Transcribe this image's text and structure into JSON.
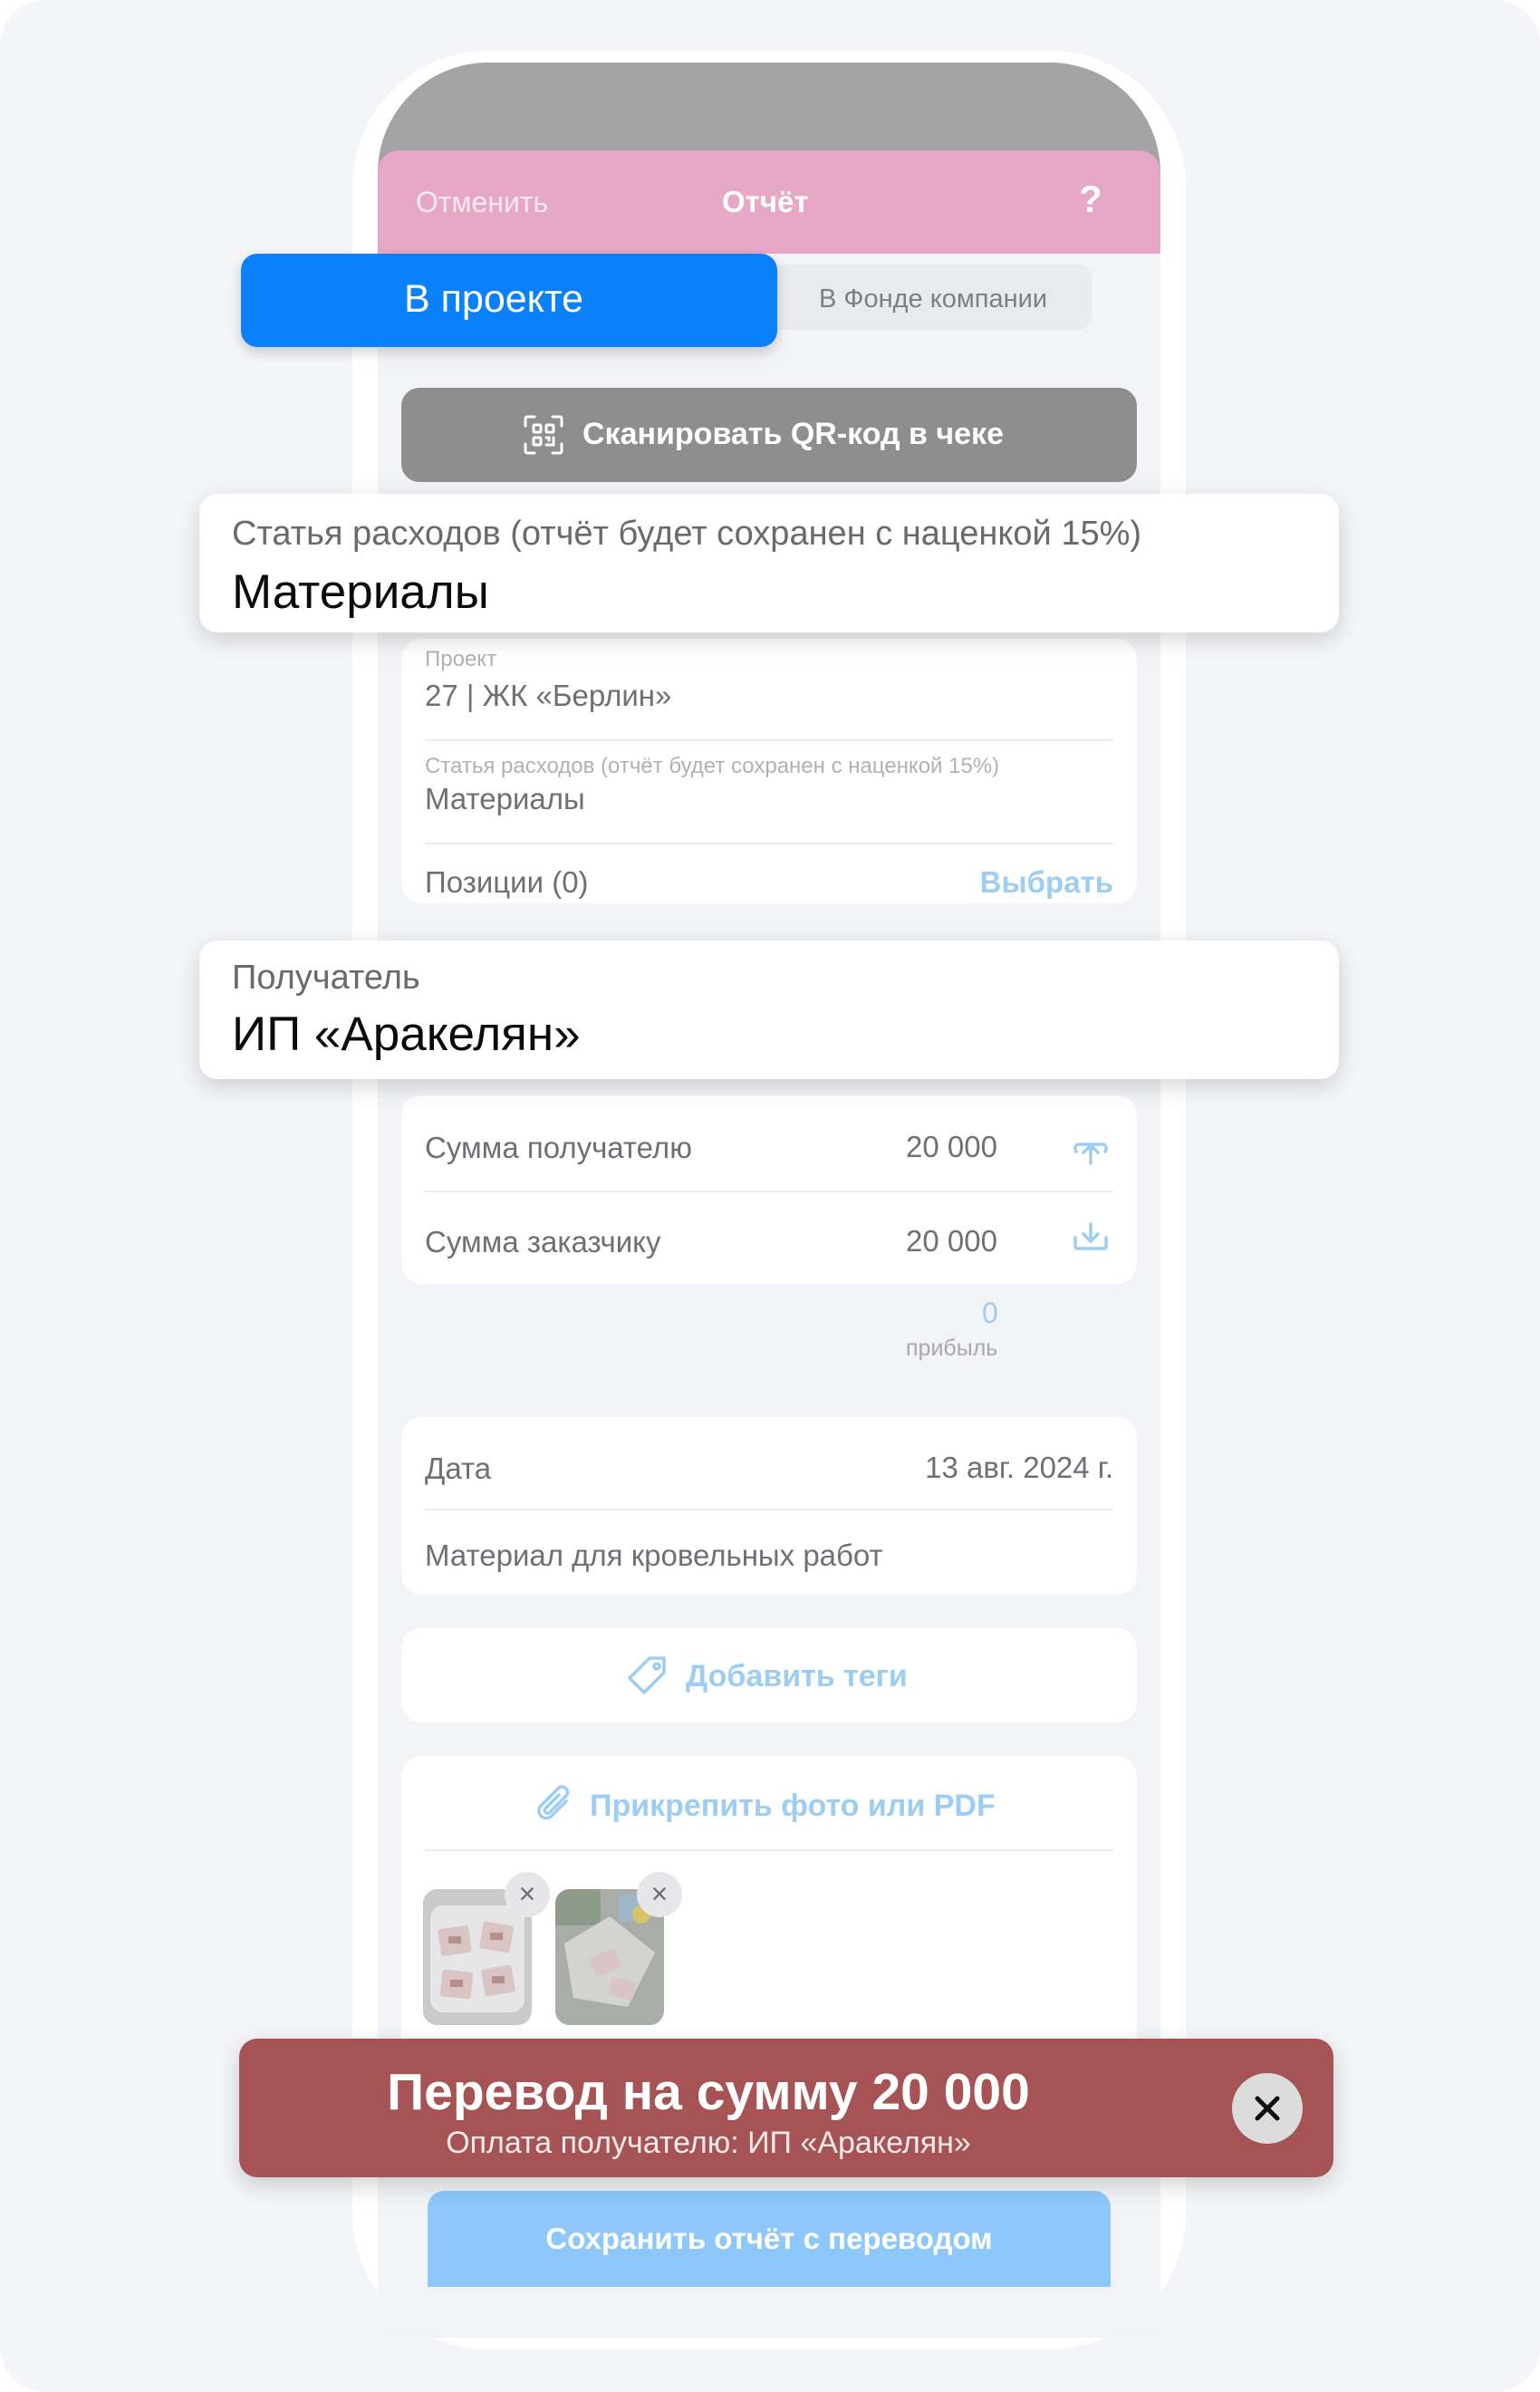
{
  "nav": {
    "cancel": "Отменить",
    "title": "Отчёт",
    "help": "?"
  },
  "segments": {
    "active": "В проекте",
    "inactive": "В Фонде компании"
  },
  "qr_button": {
    "label": "Сканировать QR-код в чеке",
    "icon": "qr-scan-icon"
  },
  "details": {
    "project_label": "Проект",
    "project_value": "27 | ЖК «Берлин»",
    "expense_label": "Статья расходов (отчёт будет сохранен с наценкой 15%)",
    "expense_value": "Материалы",
    "positions_label": "Позиции (0)",
    "positions_action": "Выбрать"
  },
  "amounts": {
    "recipient_label": "Сумма получателю",
    "recipient_value": "20 000",
    "customer_label": "Сумма заказчику",
    "customer_value": "20 000",
    "profit_value": "0",
    "profit_label": "прибыль"
  },
  "meta": {
    "date_label": "Дата",
    "date_value": "13 авг. 2024 г.",
    "comment": "Материал для кровельных работ"
  },
  "tags": {
    "label": "Добавить теги",
    "icon": "tag-icon"
  },
  "attach": {
    "label": "Прикрепить фото или PDF",
    "icon": "paperclip-icon",
    "remove": "×"
  },
  "save_button": {
    "label": "Сохранить отчёт с переводом"
  },
  "callouts": {
    "expense_label": "Статья расходов (отчёт будет сохранен с наценкой 15%)",
    "expense_value": "Материалы",
    "recipient_label": "Получатель",
    "recipient_value": "ИП «Аракелян»"
  },
  "toast": {
    "title": "Перевод на сумму 20 000",
    "subtitle": "Оплата получателю: ИП «Аракелян»"
  },
  "colors": {
    "accent": "#0a80fb",
    "navbar": "#e6a8c6",
    "toast": "#a55354",
    "link": "#9dcdf2"
  }
}
